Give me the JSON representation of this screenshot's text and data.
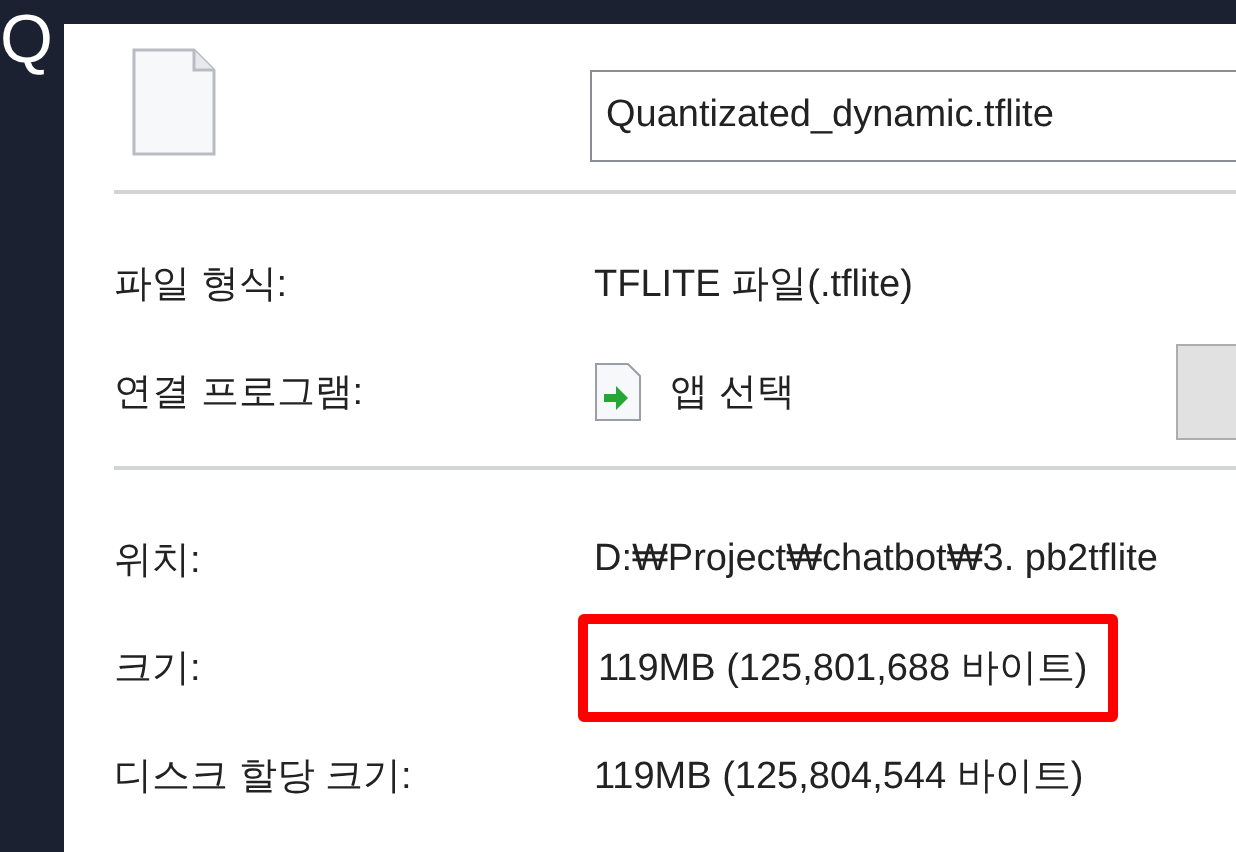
{
  "window": {
    "title": "Q"
  },
  "file": {
    "name": "Quantizated_dynamic.tflite"
  },
  "general": [
    {
      "label": "파일 형식:",
      "value": "TFLITE 파일(.tflite)",
      "kind": "text"
    },
    {
      "label": "연결 프로그램:",
      "value": "앱 선택",
      "kind": "app"
    }
  ],
  "details": [
    {
      "label": "위치:",
      "value": "D:₩Project₩chatbot₩3. pb2tflite",
      "highlighted": false
    },
    {
      "label": "크기:",
      "value": "119MB (125,801,688 바이트)",
      "highlighted": true
    },
    {
      "label": "디스크 할당 크기:",
      "value": "119MB (125,804,544 바이트)",
      "highlighted": false
    }
  ]
}
